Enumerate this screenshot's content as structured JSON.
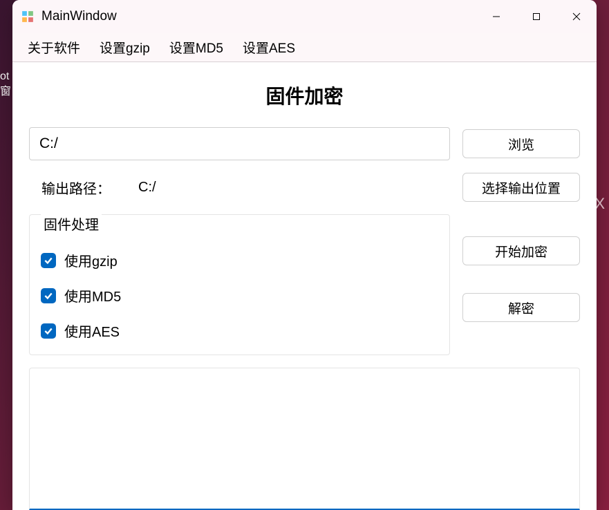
{
  "desktop_fragment": {
    "line1": "ot",
    "line2": "窗"
  },
  "window": {
    "title": "MainWindow"
  },
  "menubar": {
    "items": [
      "关于软件",
      "设置gzip",
      "设置MD5",
      "设置AES"
    ]
  },
  "page_title": "固件加密",
  "input_path": {
    "value": "C:/"
  },
  "buttons": {
    "browse": "浏览",
    "select_output": "选择输出位置",
    "start_encrypt": "开始加密",
    "decrypt": "解密"
  },
  "output": {
    "label": "输出路径：",
    "value": "C:/"
  },
  "groupbox": {
    "title": "固件处理",
    "checkboxes": [
      {
        "label": "使用gzip",
        "checked": true
      },
      {
        "label": "使用MD5",
        "checked": true
      },
      {
        "label": "使用AES",
        "checked": true
      }
    ]
  },
  "background_close": "X"
}
